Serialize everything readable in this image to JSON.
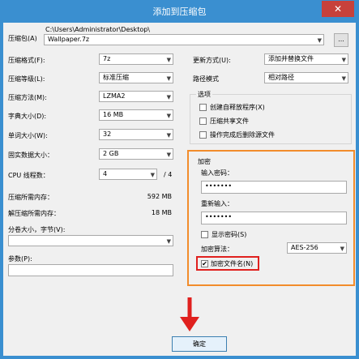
{
  "window": {
    "title": "添加到压缩包",
    "close_symbol": "✕"
  },
  "archive": {
    "label": "压缩包(A)",
    "path": "C:\\Users\\Administrator\\Desktop\\",
    "filename": "Wallpaper.7z",
    "browse": "..."
  },
  "left": {
    "format": {
      "label": "压缩格式(F):",
      "value": "7z"
    },
    "level": {
      "label": "压缩等级(L):",
      "value": "标准压缩"
    },
    "method": {
      "label": "压缩方法(M):",
      "value": "LZMA2"
    },
    "dict": {
      "label": "字典大小(D):",
      "value": "16 MB"
    },
    "word": {
      "label": "单词大小(W):",
      "value": "32"
    },
    "solid": {
      "label": "固实数据大小：",
      "value": "2 GB"
    },
    "cpu": {
      "label": "CPU 线程数：",
      "value": "4",
      "total": "/ 4"
    },
    "mem_compress": {
      "label": "压缩所需内存：",
      "value": "592 MB"
    },
    "mem_decompress": {
      "label": "解压缩所需内存：",
      "value": "18 MB"
    },
    "split": {
      "label": "分卷大小，字节(V):"
    },
    "params": {
      "label": "参数(P):"
    }
  },
  "right": {
    "update": {
      "label": "更新方式(U):",
      "value": "添加并替换文件"
    },
    "path_mode": {
      "label": "路径模式",
      "value": "相对路径"
    },
    "options": {
      "title": "选项",
      "sfx": "创建自释放程序(X)",
      "shared": "压缩共享文件",
      "delete": "操作完成后删除源文件"
    },
    "encryption": {
      "title": "加密",
      "password_label": "输入密码：",
      "password_value": "•••••••",
      "reenter_label": "重新输入：",
      "reenter_value": "•••••••",
      "show_password": "显示密码(S)",
      "method_label": "加密算法：",
      "method_value": "AES-256",
      "encrypt_names": "加密文件名(N)",
      "encrypt_names_checked": true
    }
  },
  "ok_button": "确定",
  "colors": {
    "highlight_box": "#f28c2b",
    "red_box": "#e0201e",
    "arrow": "#e0201e",
    "titlebar": "#3a8fd0"
  }
}
